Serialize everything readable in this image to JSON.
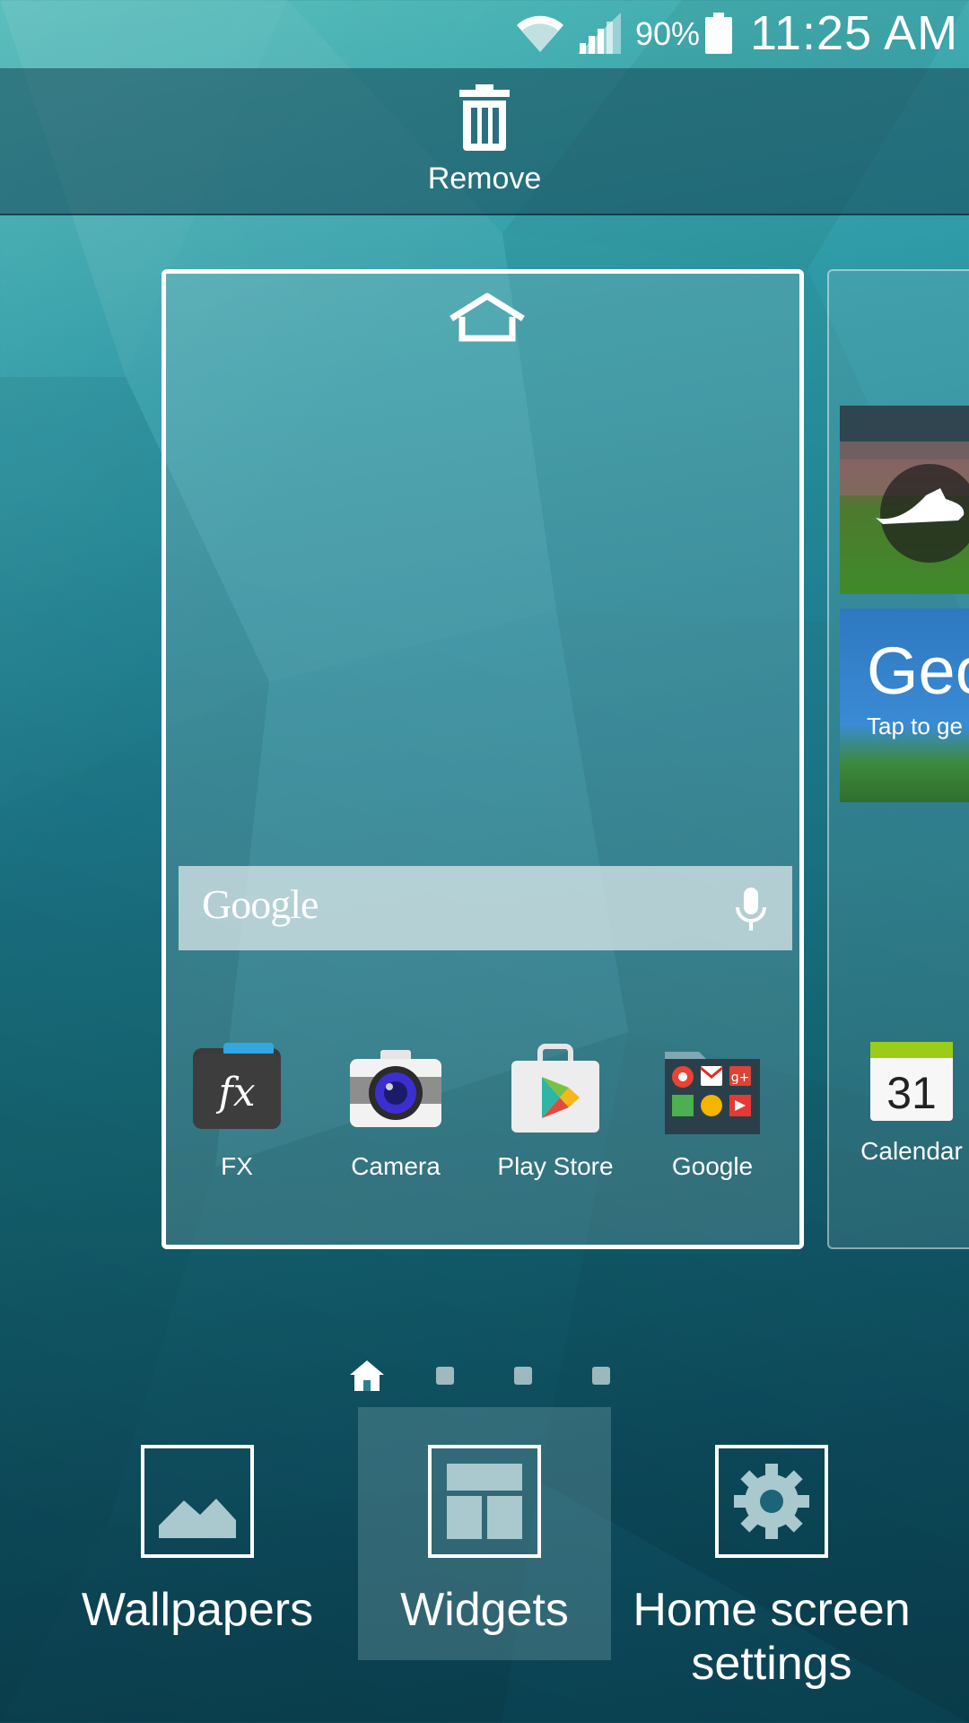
{
  "status_bar": {
    "battery_percent": "90%",
    "time": "11:25 AM",
    "icons": [
      "wifi-icon",
      "signal-icon",
      "battery-icon"
    ]
  },
  "remove": {
    "label": "Remove",
    "icon": "trash-icon"
  },
  "page": {
    "google_bar": {
      "logo": "Google",
      "icon": "mic-icon"
    },
    "apps": [
      {
        "label": "FX",
        "icon": "fx-icon"
      },
      {
        "label": "Camera",
        "icon": "camera-icon"
      },
      {
        "label": "Play Store",
        "icon": "play-store-icon"
      },
      {
        "label": "Google",
        "icon": "google-folder-icon"
      }
    ]
  },
  "next_page": {
    "geo_title": "Geo",
    "geo_subtitle": "Tap to ge",
    "calendar": {
      "label": "Calendar",
      "day": "31"
    }
  },
  "page_indicator": {
    "count": 4,
    "current": 0
  },
  "options": [
    {
      "label": "Wallpapers",
      "icon": "wallpaper-icon"
    },
    {
      "label": "Widgets",
      "icon": "widgets-icon",
      "selected": true
    },
    {
      "label": "Home screen\nsettings",
      "icon": "gear-icon"
    }
  ],
  "colors": {
    "wallpaper_top": "#4fb9b7",
    "wallpaper_bottom": "#0c4a5c",
    "frame": "#ffffff"
  }
}
